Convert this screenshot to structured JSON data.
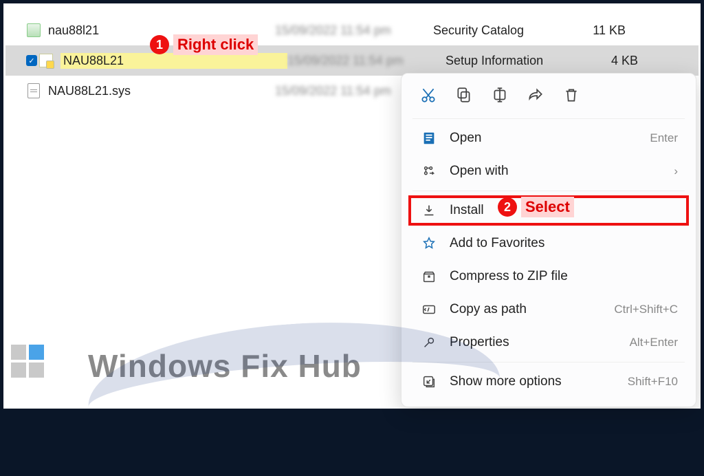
{
  "files": [
    {
      "name": "nau88l21",
      "type": "Security Catalog",
      "size": "11 KB"
    },
    {
      "name": "NAU88L21",
      "type": "Setup Information",
      "size": "4 KB"
    },
    {
      "name": "NAU88L21.sys",
      "type": "",
      "size": ""
    }
  ],
  "annotations": {
    "step1_num": "1",
    "step1_text": "Right click",
    "step2_num": "2",
    "step2_text": "Select"
  },
  "context_menu": {
    "open": {
      "label": "Open",
      "shortcut": "Enter"
    },
    "open_with": {
      "label": "Open with"
    },
    "install": {
      "label": "Install"
    },
    "favorites": {
      "label": "Add to Favorites"
    },
    "compress": {
      "label": "Compress to ZIP file"
    },
    "copypath": {
      "label": "Copy as path",
      "shortcut": "Ctrl+Shift+C"
    },
    "properties": {
      "label": "Properties",
      "shortcut": "Alt+Enter"
    },
    "more": {
      "label": "Show more options",
      "shortcut": "Shift+F10"
    }
  },
  "watermark": "Windows Fix Hub"
}
